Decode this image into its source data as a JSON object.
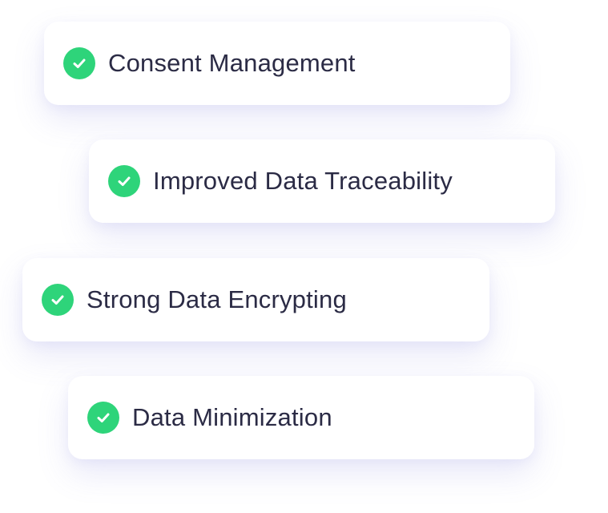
{
  "colors": {
    "check_green": "#2ed47a",
    "text": "#2b2b45",
    "card_bg": "#ffffff"
  },
  "features": [
    {
      "label": "Consent Management",
      "icon": "check-circle-icon"
    },
    {
      "label": "Improved Data Traceability",
      "icon": "check-circle-icon"
    },
    {
      "label": "Strong Data Encrypting",
      "icon": "check-circle-icon"
    },
    {
      "label": "Data Minimization",
      "icon": "check-circle-icon"
    }
  ]
}
